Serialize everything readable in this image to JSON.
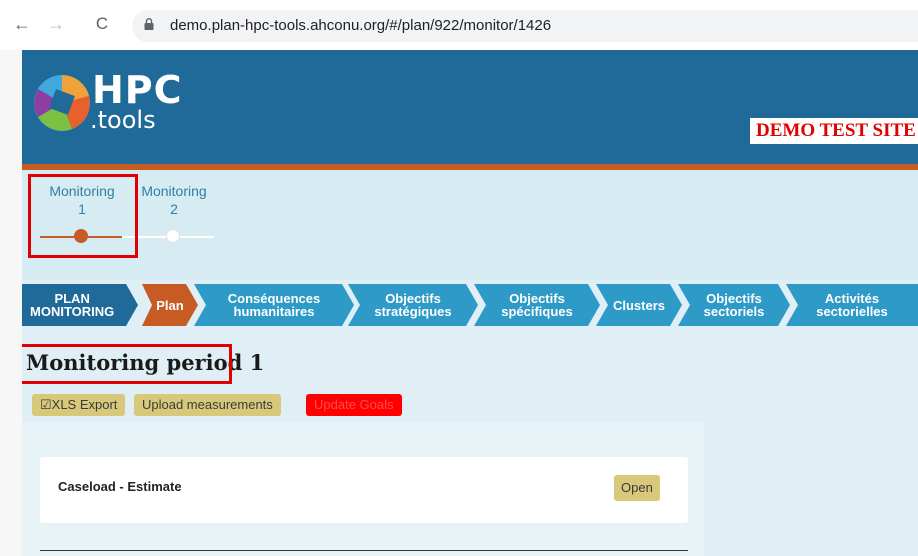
{
  "browser": {
    "back": "←",
    "forward": "→",
    "reload": "C",
    "url": "demo.plan-hpc-tools.ahconu.org/#/plan/922/monitor/1426"
  },
  "header": {
    "logo_line1": "HPC",
    "logo_line2": ".tools",
    "demo_label": "DEMO TEST SITE"
  },
  "periods": [
    {
      "label": "Monitoring",
      "number": "1"
    },
    {
      "label": "Monitoring",
      "number": "2"
    }
  ],
  "steps": [
    {
      "label": "PLAN\nMONITORING"
    },
    {
      "label": "Plan"
    },
    {
      "label": "Conséquences\nhumanitaires"
    },
    {
      "label": "Objectifs\nstratégiques"
    },
    {
      "label": "Objectifs\nspécifiques"
    },
    {
      "label": "Clusters"
    },
    {
      "label": "Objectifs\nsectoriels"
    },
    {
      "label": "Activités\nsectorielles"
    }
  ],
  "main": {
    "title": "Monitoring period 1",
    "actions": {
      "xls_export": "☑XLS Export",
      "upload": "Upload measurements",
      "update": "Update Goals"
    },
    "card": {
      "title": "Caseload - Estimate",
      "open": "Open"
    }
  },
  "colors": {
    "header": "#1f6a98",
    "accent": "#c65b23",
    "step": "#2d9ac7",
    "highlight": "#e00000"
  }
}
